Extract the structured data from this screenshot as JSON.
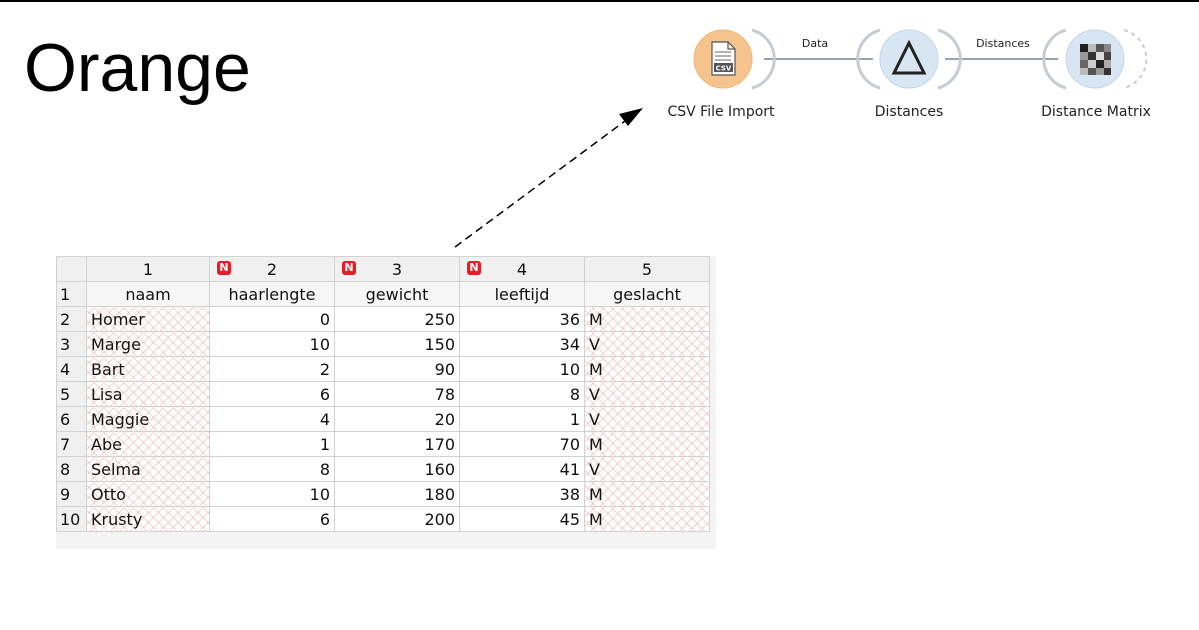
{
  "slide": {
    "title": "Orange"
  },
  "workflow": {
    "widgets": [
      {
        "label": "CSV File Import",
        "icon": "csv-file-icon",
        "color": "#f5c38e"
      },
      {
        "label": "Distances",
        "icon": "delta-icon",
        "color": "#d7e6f2"
      },
      {
        "label": "Distance Matrix",
        "icon": "matrix-icon",
        "color": "#d7e6f2"
      }
    ],
    "links": [
      {
        "label": "Data"
      },
      {
        "label": "Distances"
      }
    ],
    "csv_badge": "CSV"
  },
  "sheet": {
    "col_numbers": [
      "1",
      "2",
      "3",
      "4",
      "5"
    ],
    "numeric_flag": "N",
    "numeric_flag_color": "#e41e26",
    "row_numbers": [
      "1",
      "2",
      "3",
      "4",
      "5",
      "6",
      "7",
      "8",
      "9",
      "10"
    ],
    "headers": [
      "naam",
      "haarlengte",
      "gewicht",
      "leeftijd",
      "geslacht"
    ],
    "rows": [
      [
        "Homer",
        "0",
        "250",
        "36",
        "M"
      ],
      [
        "Marge",
        "10",
        "150",
        "34",
        "V"
      ],
      [
        "Bart",
        "2",
        "90",
        "10",
        "M"
      ],
      [
        "Lisa",
        "6",
        "78",
        "8",
        "V"
      ],
      [
        "Maggie",
        "4",
        "20",
        "1",
        "V"
      ],
      [
        "Abe",
        "1",
        "170",
        "70",
        "M"
      ],
      [
        "Selma",
        "8",
        "160",
        "41",
        "V"
      ],
      [
        "Otto",
        "10",
        "180",
        "38",
        "M"
      ],
      [
        "Krusty",
        "6",
        "200",
        "45",
        "M"
      ]
    ]
  }
}
